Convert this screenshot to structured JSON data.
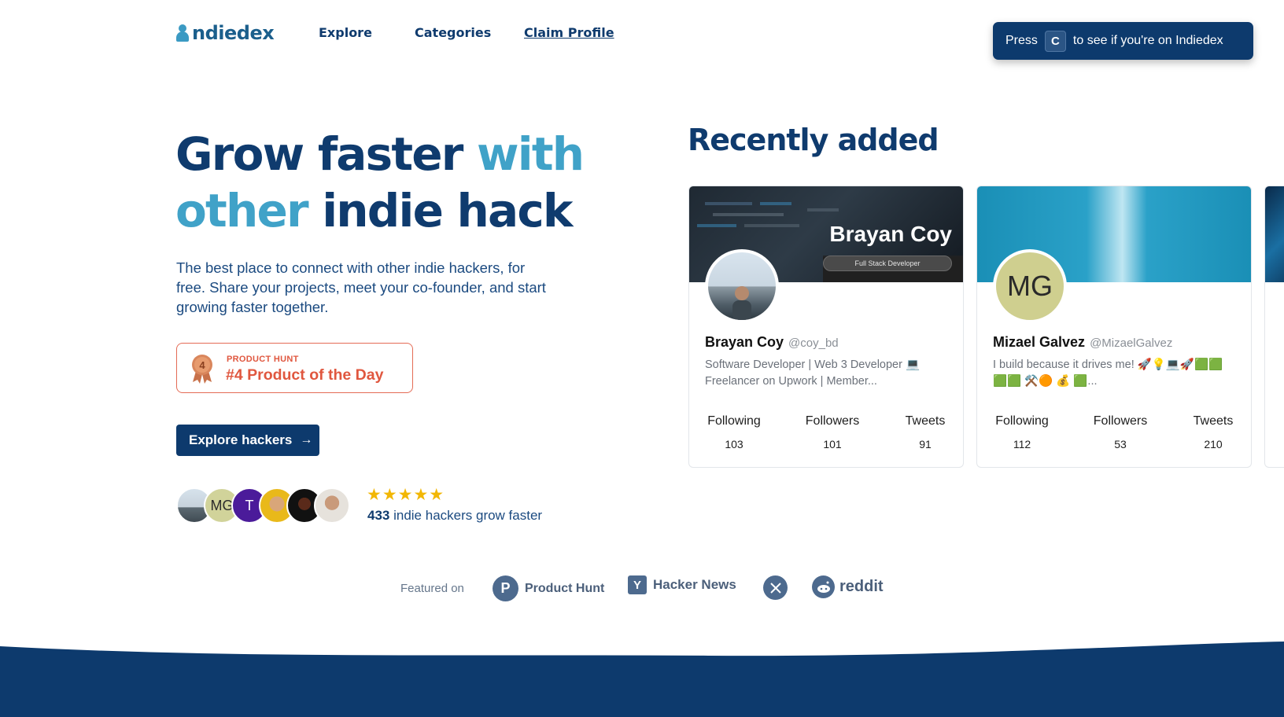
{
  "nav": {
    "logo_text": "ndiedex",
    "links": [
      "Explore",
      "Categories",
      "Claim Profile"
    ],
    "press_prefix": "Press",
    "press_key": "C",
    "press_suffix": "to see if you're on Indiedex"
  },
  "hero": {
    "title_part1": "Grow faster ",
    "title_part2": "with",
    "title_part3": "other",
    "title_part4": " indie hack",
    "subtitle": "The best place to connect with other indie hackers, for free. Share your projects, meet your co-founder, and start growing faster together.",
    "ph_small": "PRODUCT HUNT",
    "ph_big": "#4 Product of the Day",
    "ph_medal_number": "4",
    "explore_button": "Explore hackers",
    "stars": "★★★★★",
    "hackers_count": "433",
    "hackers_text": " indie hackers grow faster",
    "avatar_initials": [
      "MG",
      "T"
    ]
  },
  "recent": {
    "title": "Recently added",
    "cards": [
      {
        "banner_name": "Brayan Coy",
        "banner_role": "Full Stack Developer",
        "name": "Brayan Coy",
        "handle": "@coy_bd",
        "bio": "Software Developer | Web 3 Developer 💻 Freelancer on Upwork | Member...",
        "stats": [
          {
            "label": "Following",
            "value": "103"
          },
          {
            "label": "Followers",
            "value": "101"
          },
          {
            "label": "Tweets",
            "value": "91"
          }
        ]
      },
      {
        "initials": "MG",
        "name": "Mizael Galvez",
        "handle": "@MizaelGalvez",
        "bio": "I build because it drives me! 🚀💡💻🚀🟩🟩🟩🟩 ⚒️🟠 💰 🟩...",
        "stats": [
          {
            "label": "Following",
            "value": "112"
          },
          {
            "label": "Followers",
            "value": "53"
          },
          {
            "label": "Tweets",
            "value": "210"
          }
        ]
      }
    ]
  },
  "featured": {
    "label": "Featured on",
    "items": [
      "Product Hunt",
      "Hacker News",
      "reddit"
    ],
    "ph_letter": "P",
    "hn_letter": "Y"
  },
  "colors": {
    "brand_navy": "#0d3a6d",
    "accent_blue": "#40a2c8",
    "product_hunt_orange": "#e0573f",
    "star_yellow": "#f2b705"
  }
}
